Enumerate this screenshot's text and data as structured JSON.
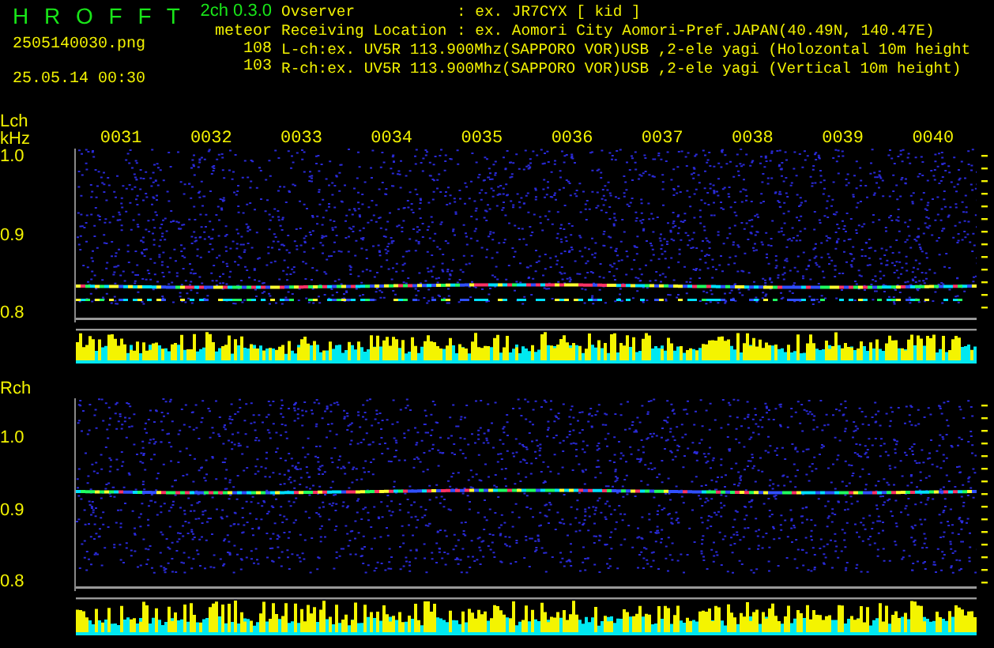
{
  "header": {
    "title": "H R O F F T",
    "version": "2ch 0.3.0",
    "filename": "2505140030.png",
    "timestamp": "25.05.14 00:30",
    "meteor_label": "meteor",
    "counts": [
      "108",
      "103"
    ],
    "info": [
      {
        "label": "Ovserver",
        "value": ": ex. JR7CYX [ kid ]"
      },
      {
        "label": "Receiving Location",
        "value": ": ex. Aomori City Aomori-Pref.JAPAN(40.49N, 140.47E)"
      }
    ],
    "channel_lines": [
      "L-ch:ex. UV5R 113.900Mhz(SAPPORO VOR)USB ,2-ele yagi (Holozontal 10m height",
      "R-ch:ex. UV5R 113.900Mhz(SAPPORO VOR)USB ,2-ele yagi (Vertical 10m height)"
    ]
  },
  "time_labels": [
    "0031",
    "0032",
    "0033",
    "0034",
    "0035",
    "0036",
    "0037",
    "0038",
    "0039",
    "0040"
  ],
  "channels": [
    {
      "label": "Lch",
      "unit": "kHz",
      "y_labels": [
        "1.0",
        "0.9",
        "0.8"
      ]
    },
    {
      "label": "Rch",
      "y_labels": [
        "1.0",
        "0.9",
        "0.8"
      ]
    }
  ]
}
